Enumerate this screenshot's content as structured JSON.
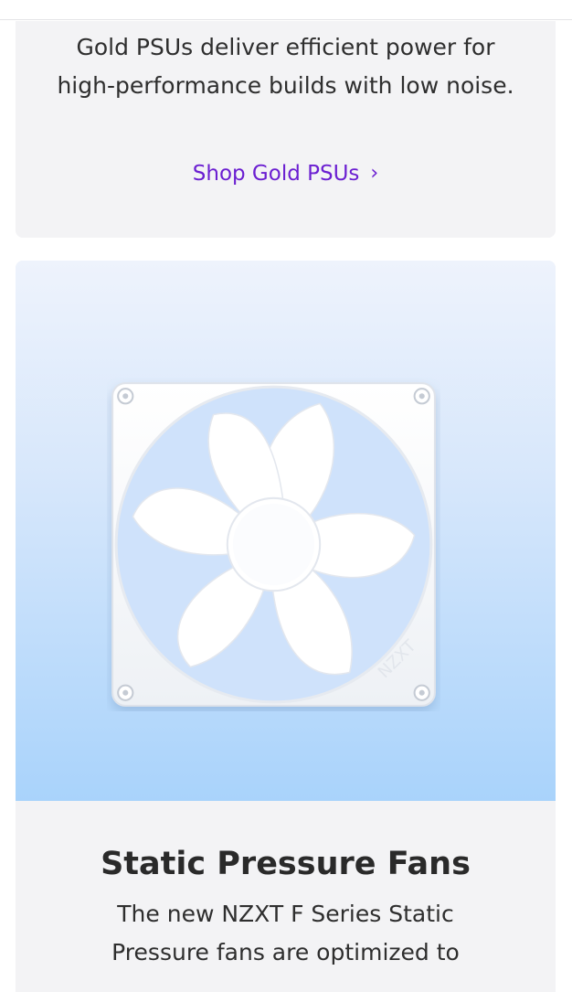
{
  "psu_card": {
    "description": "Gold PSUs deliver efficient power for high-performance builds with low noise.",
    "link_label": "Shop Gold PSUs",
    "link_chevron": "›"
  },
  "fan_card": {
    "image_icon": "white-case-fan",
    "title": "Static Pressure Fans",
    "description": "The new NZXT F Series Static Pressure fans are optimized to",
    "fan_logo_text": "NZXT"
  },
  "colors": {
    "link": "#6b1fd1",
    "card_bg": "#f3f3f5",
    "hero_top": "#eef3fc",
    "hero_bottom": "#a9d3fb"
  }
}
